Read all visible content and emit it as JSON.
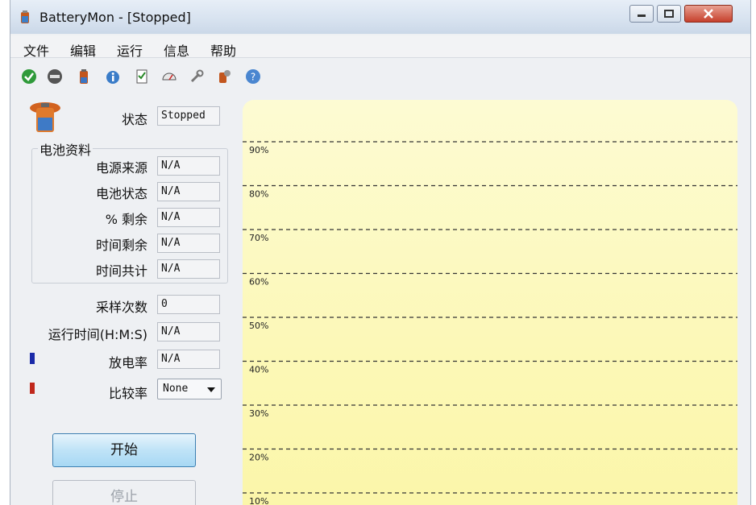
{
  "window": {
    "title": "BatteryMon - [Stopped]"
  },
  "menu": [
    "文件",
    "编辑",
    "运行",
    "信息",
    "帮助"
  ],
  "toolbar": [
    "start-icon",
    "stop-icon",
    "battery-icon",
    "info-icon",
    "report-icon",
    "gauge-icon",
    "wrench-icon",
    "settings-icon",
    "help-icon"
  ],
  "status": {
    "label": "状态",
    "value": "Stopped"
  },
  "battery_info": {
    "group_title": "电池资料",
    "fields": [
      {
        "label": "电源来源",
        "value": "N/A"
      },
      {
        "label": "电池状态",
        "value": "N/A"
      },
      {
        "label": "% 剩余",
        "value": "N/A"
      },
      {
        "label": "时间剩余",
        "value": "N/A"
      },
      {
        "label": "时间共计",
        "value": "N/A"
      }
    ]
  },
  "samples": {
    "label": "采样次数",
    "value": "0"
  },
  "runtime": {
    "label": "运行时间(H:M:S)",
    "value": "N/A"
  },
  "discharge": {
    "label": "放电率",
    "value": "N/A",
    "color": "#1a2aa8"
  },
  "compare": {
    "label": "比较率",
    "value": "None",
    "color": "#c0281c"
  },
  "buttons": {
    "start": "开始",
    "stop": "停止"
  },
  "chart_data": {
    "type": "line",
    "title": "",
    "xlabel": "",
    "ylabel": "",
    "y_ticks": [
      "90%",
      "80%",
      "70%",
      "60%",
      "50%",
      "40%",
      "30%",
      "20%",
      "10%"
    ],
    "ylim": [
      0,
      100
    ],
    "grid": true,
    "series": []
  }
}
